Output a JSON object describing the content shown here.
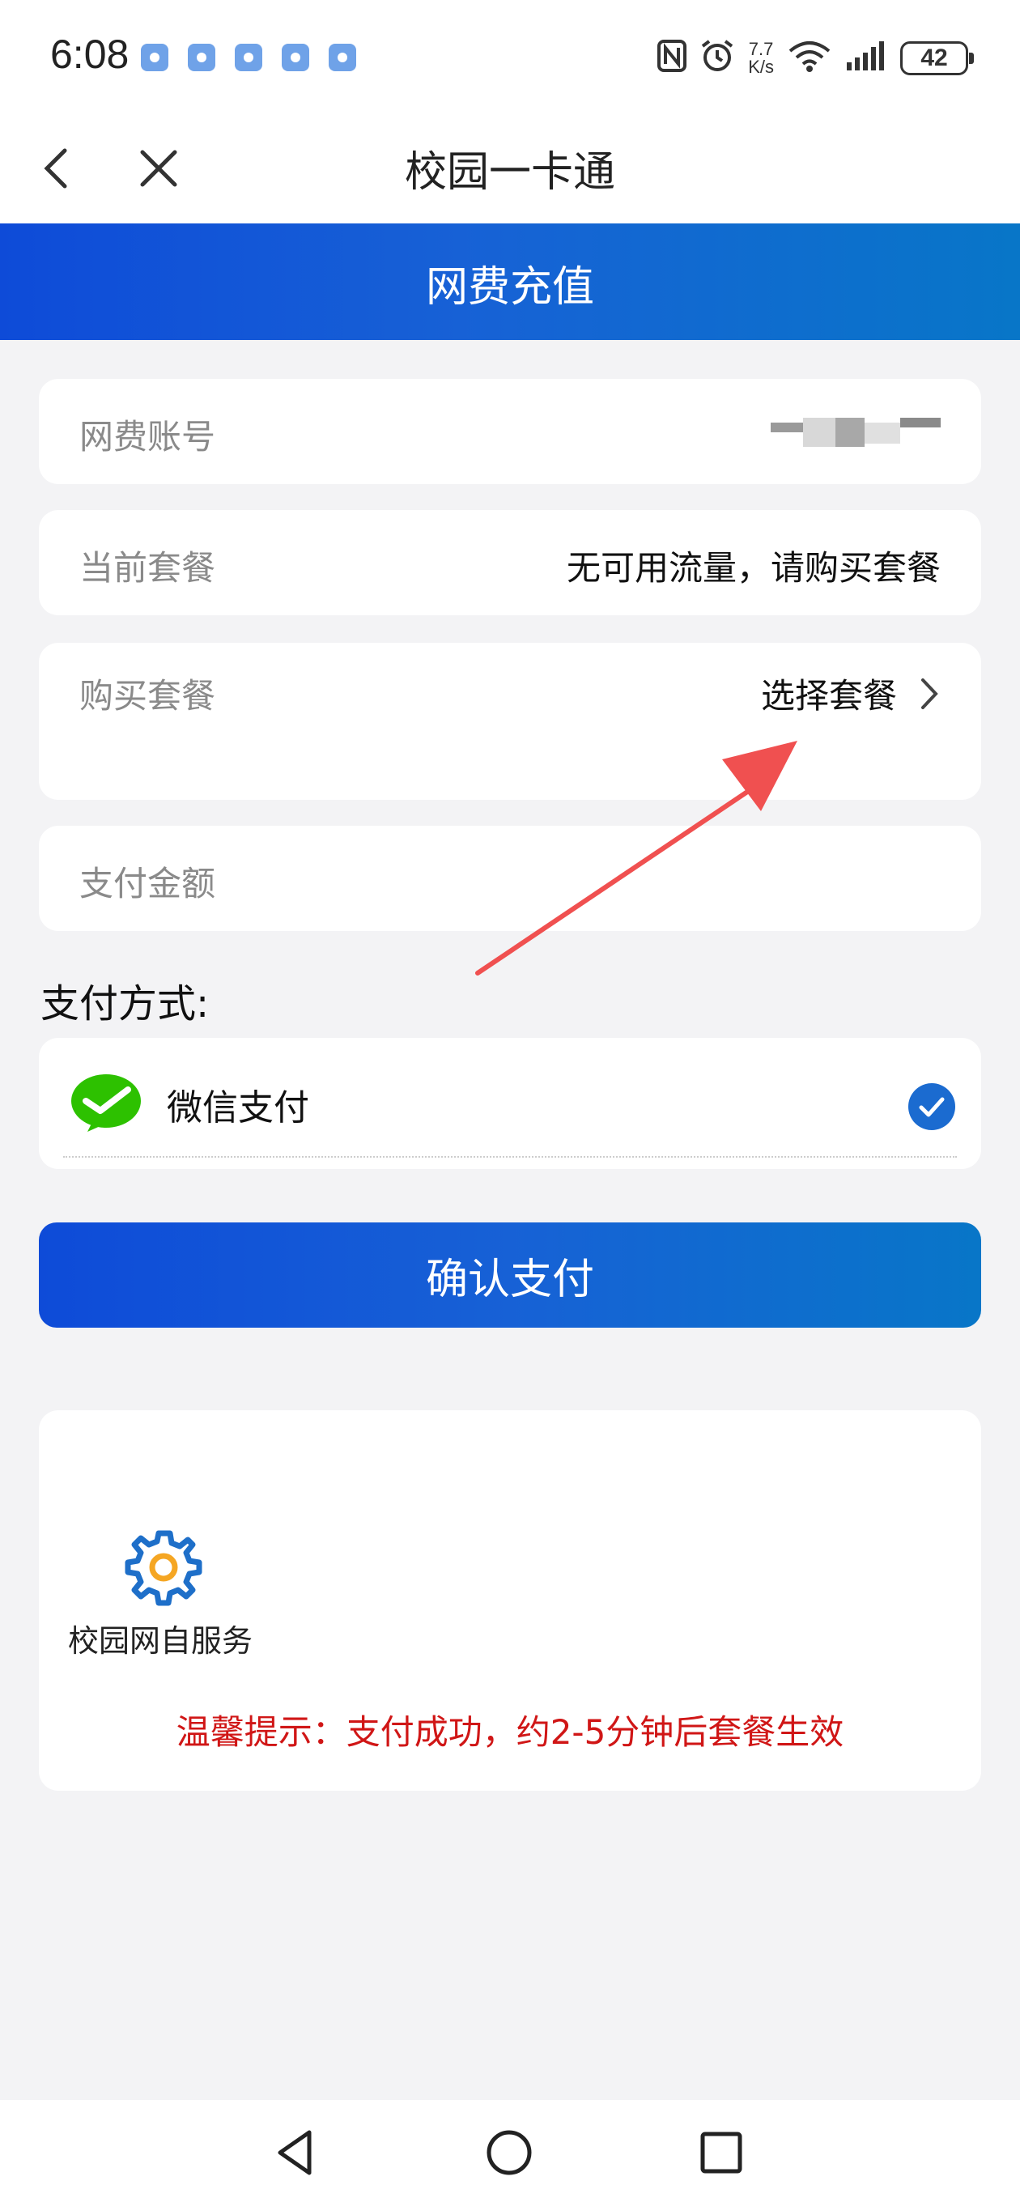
{
  "status_bar": {
    "time": "6:08",
    "net_speed_value": "7.7",
    "net_speed_unit": "K/s",
    "battery": "42"
  },
  "app": {
    "title": "校园一卡通"
  },
  "banner": {
    "title": "网费充值"
  },
  "form": {
    "account_label": "网费账号",
    "account_value_masked": "5∙∙∙∙∙∙15",
    "plan_label": "当前套餐",
    "plan_value": "无可用流量，请购买套餐",
    "buy_label": "购买套餐",
    "buy_value": "选择套餐",
    "amount_label": "支付金额"
  },
  "payment": {
    "section_title": "支付方式:",
    "methods": [
      {
        "name": "微信支付",
        "selected": true
      }
    ]
  },
  "confirm_button": "确认支付",
  "service": {
    "label": "校园网自服务",
    "tip": "温馨提示：支付成功，约2-5分钟后套餐生效"
  },
  "colors": {
    "primary_blue": "#1761d6",
    "tip_red": "#d01616",
    "wechat_green": "#2dc100",
    "arrow_red": "#f05050"
  }
}
